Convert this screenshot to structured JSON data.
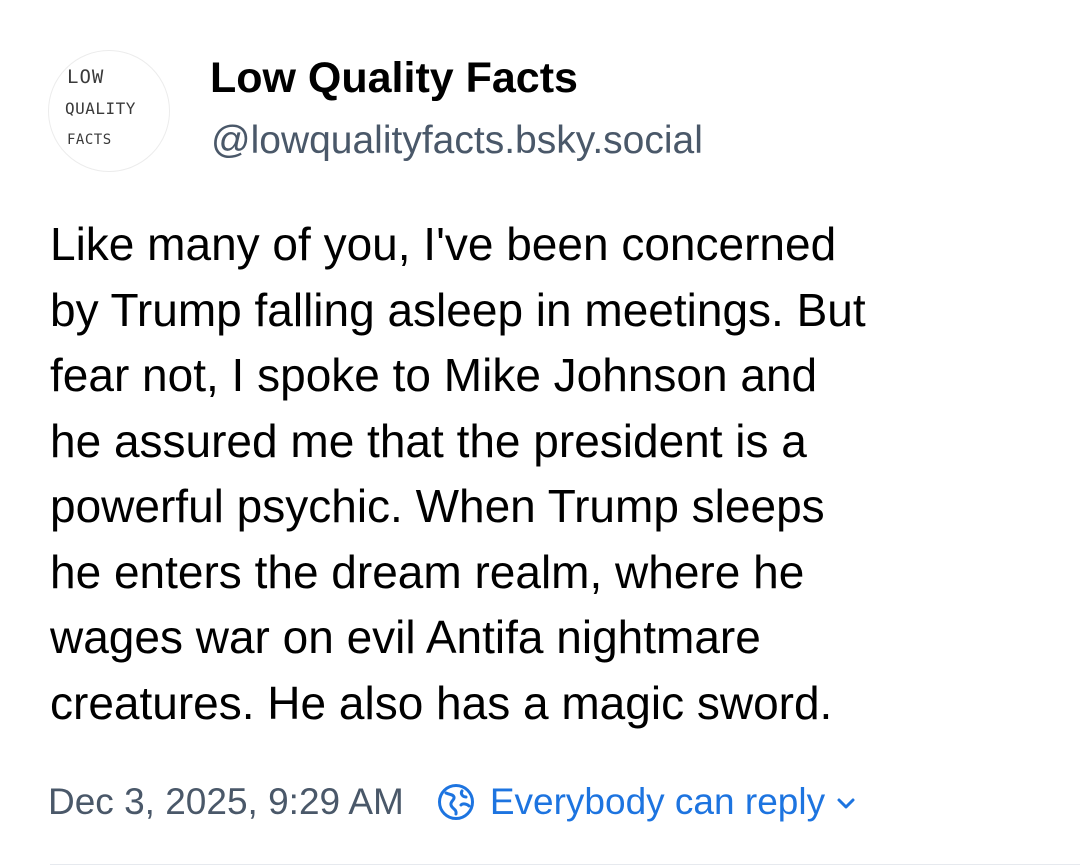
{
  "author": {
    "display_name": "Low Quality Facts",
    "handle": "@lowqualityfacts.bsky.social",
    "avatar_text": [
      "LOW",
      "QUALITY",
      "FACTS"
    ]
  },
  "post": {
    "text_lines": [
      "Like many of you, I've been concerned",
      "by Trump falling asleep in meetings. But",
      "fear not, I spoke to Mike Johnson and",
      "he assured me that the president is a",
      "powerful psychic. When Trump sleeps",
      "he enters the dream realm, where he",
      "wages war on evil Antifa nightmare",
      "creatures. He also has a magic sword."
    ],
    "timestamp": "Dec 3, 2025, 9:29 AM",
    "reply_setting": "Everybody can reply"
  },
  "icons": {
    "reply_setting_icon": "globe-icon",
    "reply_dropdown_icon": "chevron-down-icon"
  },
  "colors": {
    "name": "#000000",
    "handle": "#4a5869",
    "body_text": "#000000",
    "timestamp": "#4a5869",
    "accent": "#1d74e0"
  }
}
